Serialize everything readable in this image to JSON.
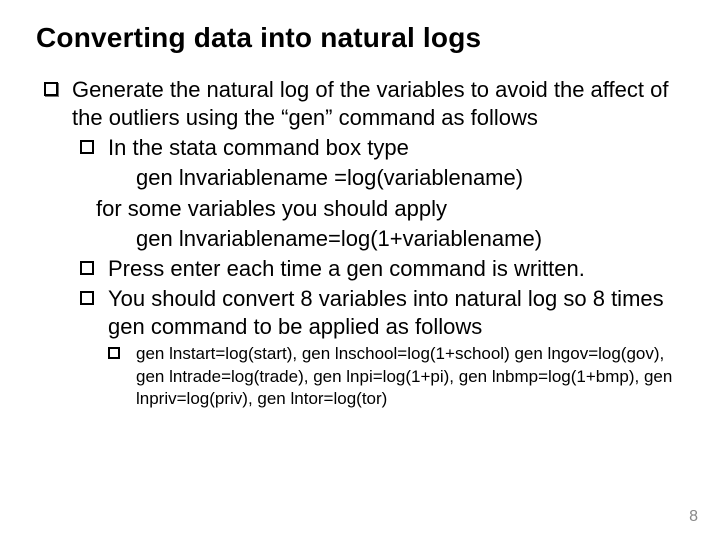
{
  "title": "Converting data into natural logs",
  "b1": "Generate the natural log of the variables to avoid the affect of the outliers using the “gen” command as follows",
  "b1a": "In the stata command box type",
  "code1": "gen lnvariablename =log(variablename)",
  "b1b": "for some variables you should apply",
  "code2": "gen lnvariablename=log(1+variablename)",
  "b1c": "Press enter each time a gen command is written.",
  "b1d": "You should convert 8 variables into natural log so 8 times gen command to be applied as follows",
  "cmds1": "gen lnstart=log(start), gen lnschool=log(1+school) gen lngov=log(gov), gen lntrade=log(trade), gen lnpi=log(1+pi), gen lnbmp=log(1+bmp), gen lnpriv=log(priv), gen lntor=log(tor)",
  "page": "8",
  "chart_data": null
}
